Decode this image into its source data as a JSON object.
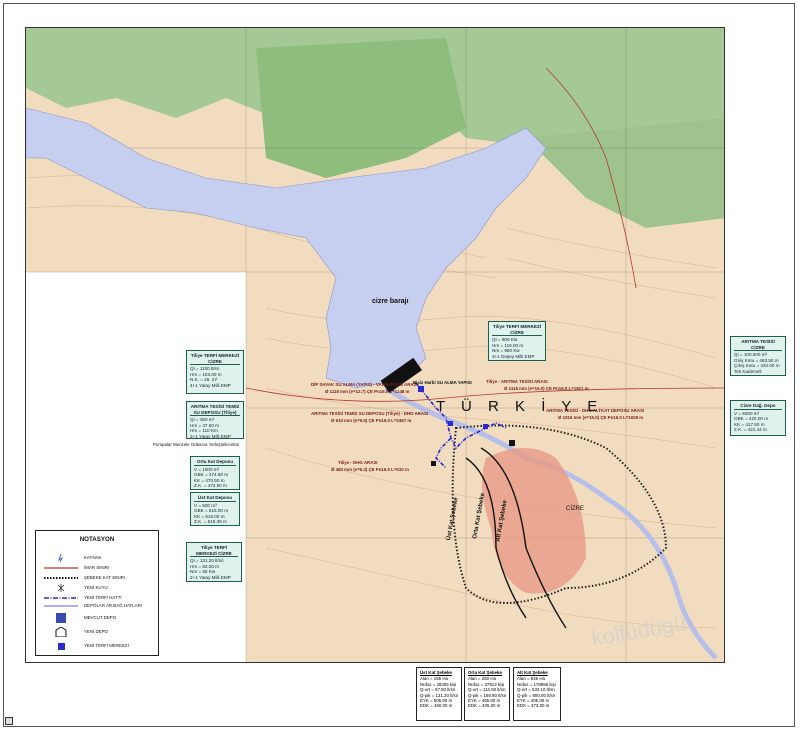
{
  "map": {
    "dam_label": "cizre barajı",
    "country_label": "T Ü R K İ Y E",
    "watermark": "kolfüdügü"
  },
  "callouts": [
    {
      "id": "depo-terfi-left",
      "title": "Tiliye TERFİ MERKEZİ CİZRE",
      "rows": [
        "Qi = 1100 lt/sn",
        "Hm = 103.00 m",
        "N.K. = 45. m²",
        "4+1 Yatay Milli EMP"
      ]
    },
    {
      "id": "aritma-temiz",
      "title": "ARITMA TESİSİ TEMİZ SU DEPOSU (Tiliye)",
      "rows": [
        "Qi = 350 m³",
        "Hm = 47.00 m",
        "Hm = 110 Km",
        "2+1 Yatay Milli EMP"
      ]
    },
    {
      "id": "orta-depo",
      "title": "Orta Kat Deposu",
      "rows": [
        "V = 1000 m³",
        "GBK = 474.50 m",
        "KK = 470.50 m",
        "Z.K. = 473.90 m"
      ]
    },
    {
      "id": "ust-depo",
      "title": "Üst Kat Deposu",
      "rows": [
        "V = 500 m³",
        "GBK = 516.00 m",
        "KK = 515.00 m",
        "Z.K. = 516.39 m"
      ]
    },
    {
      "id": "terfi-bottom",
      "title": "Tiliye TERFİ MERKEZİ CİZRE",
      "rows": [
        "Qi = 131.20 lt/sn",
        "Hm = 83.00 m",
        "Nm = 55 Kw",
        "2+1 Yatay Milli EMP"
      ]
    },
    {
      "id": "terfi-top-right",
      "title": "Tiliye TERFİ MERKEZİ CİZRE",
      "rows": [
        "Qi = 900 Kla",
        "Hm = 116.00 m",
        "Nm = 980 Kw",
        "3+1 Düşey Milli EMP"
      ]
    },
    {
      "id": "aritma-right",
      "title": "ARITMA TESİSİ CİZRE",
      "rows": [
        "Qi = 100.000 m³",
        "Giriş Kotu = 463.50 m",
        "Çıkış Kotu = 434.00 m",
        "Tek Kademeli"
      ]
    },
    {
      "id": "cizre-depo",
      "title": "Cizre Dağ. Depo",
      "rows": [
        "V = 5000 m³",
        "GBK = 420.00 m",
        "KK = 417.50 m",
        "Z.K. = 421.44 m"
      ]
    }
  ],
  "route_labels": [
    "DİP SAVAK SU ALMA (YAPIS) - VANA ODASI ARASI",
    "Ø 1118 mm (e=12.7) ÇE Pn16.0 L=1148 m",
    "ARITMA TESİSİ TEMİZ SU DEPOSU (Tiliye) - DHG ARASI",
    "Ø 610 mm (e=9.5) ÇE Pn16.0 L=2467 m",
    "Tiliye - DHG ARASI",
    "Ø 483 mm (e=6.3) ÇE Pn16.0 L=510 m",
    "Tiliye - ARITMA TESİSİ ARASI",
    "Ø 1118 mm (e=16.0) ÇE Pn16.0 L=1921 m",
    "ARITMA TESİSİ - DHG ALTKAT DEPOSU ARASI",
    "Ø 1016 mm (e=15.0) ÇE Pn16.0 L=1029 m",
    "Bisiz Harbi SU ALMA YAPISI",
    "Pompalar Menzele Odasına Yerleştirilecektir"
  ],
  "zones": [
    "Üst Kat Şebeke",
    "Orta Kat Şebeke",
    "Alt Kat Şebeke",
    "CİZRE"
  ],
  "legend": {
    "title": "NOTASYON",
    "items": [
      {
        "icon": "spring-icon",
        "label": "KAYNAK"
      },
      {
        "icon": "zoning-boundary-icon",
        "label": "İMAR SINIRI"
      },
      {
        "icon": "network-boundary-icon",
        "label": "ŞEBEKE KAT SINIRI"
      },
      {
        "icon": "new-well-icon",
        "label": "YENİ KUYU"
      },
      {
        "icon": "new-pipeline-icon",
        "label": "YENİ TERFİ HATTI"
      },
      {
        "icon": "distribution-line-icon",
        "label": "DEPOLAR AR.BAĞ.HATLARI"
      },
      {
        "icon": "existing-tank-icon",
        "label": "MEVCUT DEPO"
      },
      {
        "icon": "new-tank-icon",
        "label": "YENİ DEPO"
      },
      {
        "icon": "new-pump-station-icon",
        "label": "YENİ TERFİ MERKEZİ"
      }
    ]
  },
  "stats": [
    {
      "title": "Üst Kat Şebeke",
      "rows": [
        "Alan = 155 Ha",
        "Nüfus = 28305 kişi",
        "Q-ort = 87.50 lt/sn",
        "Q-pik = 131.20 lt/sn",
        "EYK = 505.00 m",
        "EDK = 450.00 m"
      ]
    },
    {
      "title": "Orta Kat Şebeke",
      "rows": [
        "Alan = 250 Ha",
        "Nüfus = 37913 kişi",
        "Q-ort = 112.50 lt/sn",
        "Q-pik = 168.90 lt/sn",
        "EYK = 465.00 m",
        "EDK = 405.00 m"
      ]
    },
    {
      "title": "Alt Kat Şebeke",
      "rows": [
        "Alan = 945 Ha",
        "Nüfus = 178868 kişi",
        "Q-ort = 533.10 lt/sn",
        "Q-pik = 800.00 lt/sn",
        "EYK = 405.00 m",
        "EDK = 373.00 m"
      ]
    }
  ],
  "colors": {
    "water": "#c7cff0",
    "forest": "#9cc48c",
    "terrain": "#f2dcc0",
    "pipeline": "#2a2ad0",
    "callout_bg": "#dff3ec"
  }
}
